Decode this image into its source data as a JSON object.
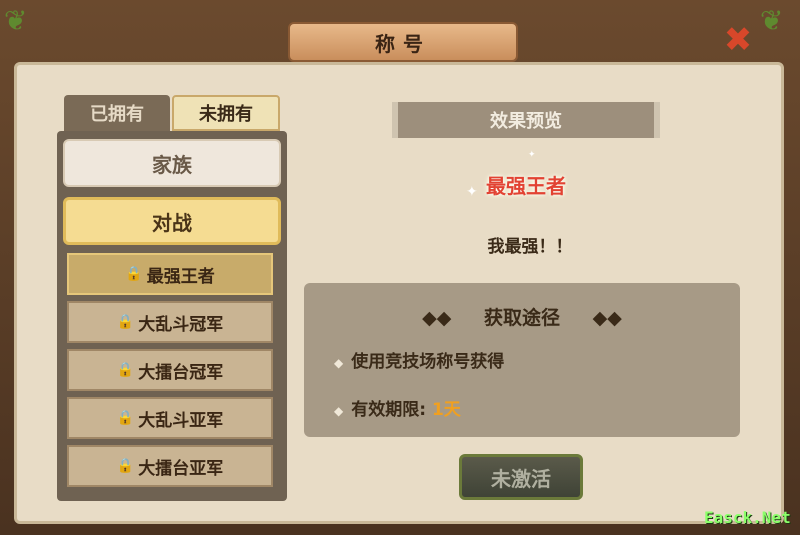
{
  "window": {
    "title": "称号"
  },
  "tabs": [
    {
      "label": "已拥有"
    },
    {
      "label": "未拥有"
    }
  ],
  "categories": [
    {
      "label": "家族"
    },
    {
      "label": "对战"
    }
  ],
  "titles": [
    {
      "label": "最强王者"
    },
    {
      "label": "大乱斗冠军"
    },
    {
      "label": "大擂台冠军"
    },
    {
      "label": "大乱斗亚军"
    },
    {
      "label": "大擂台亚军"
    }
  ],
  "preview": {
    "header": "效果预览",
    "title_name": "最强王者",
    "description": "我最强！！"
  },
  "acquire": {
    "title": "获取途径",
    "method": "使用竞技场称号获得",
    "validity_label": "有效期限:",
    "validity_value": "1天"
  },
  "activate_button": "未激活",
  "watermark": "Easck.Net",
  "colors": {
    "title_red": "#e24232",
    "days_orange": "#f0a020",
    "selected_gold": "#f5dc92"
  }
}
